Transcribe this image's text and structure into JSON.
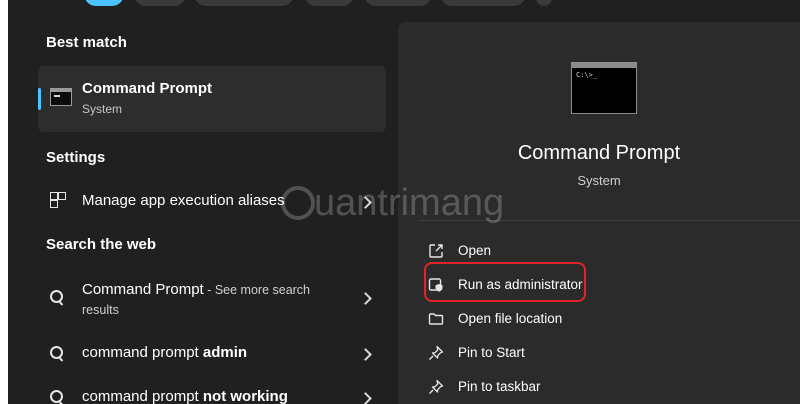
{
  "left": {
    "best_match_title": "Best match",
    "best_match": {
      "name": "Command Prompt",
      "type": "System"
    },
    "settings_title": "Settings",
    "settings_item": "Manage app execution aliases",
    "web_title": "Search the web",
    "web_results": [
      {
        "main": "Command Prompt",
        "suffix": " - See more search",
        "extra": "results"
      },
      {
        "prefix": "command prompt ",
        "bold": "admin"
      },
      {
        "prefix": "command prompt ",
        "bold": "not working"
      }
    ]
  },
  "preview": {
    "title": "Command Prompt",
    "subtitle": "System",
    "icon_text": "C:\\>_",
    "actions": [
      {
        "label": "Open",
        "icon": "open-external-icon"
      },
      {
        "label": "Run as administrator",
        "icon": "shield-window-icon",
        "highlighted": true
      },
      {
        "label": "Open file location",
        "icon": "folder-icon"
      },
      {
        "label": "Pin to Start",
        "icon": "pin-icon"
      },
      {
        "label": "Pin to taskbar",
        "icon": "pin-icon"
      }
    ]
  },
  "watermark": "uantrimang",
  "colors": {
    "accent": "#4cc2ff",
    "highlight": "#e0242a",
    "panel": "#202020",
    "pane": "#2b2b2b"
  }
}
